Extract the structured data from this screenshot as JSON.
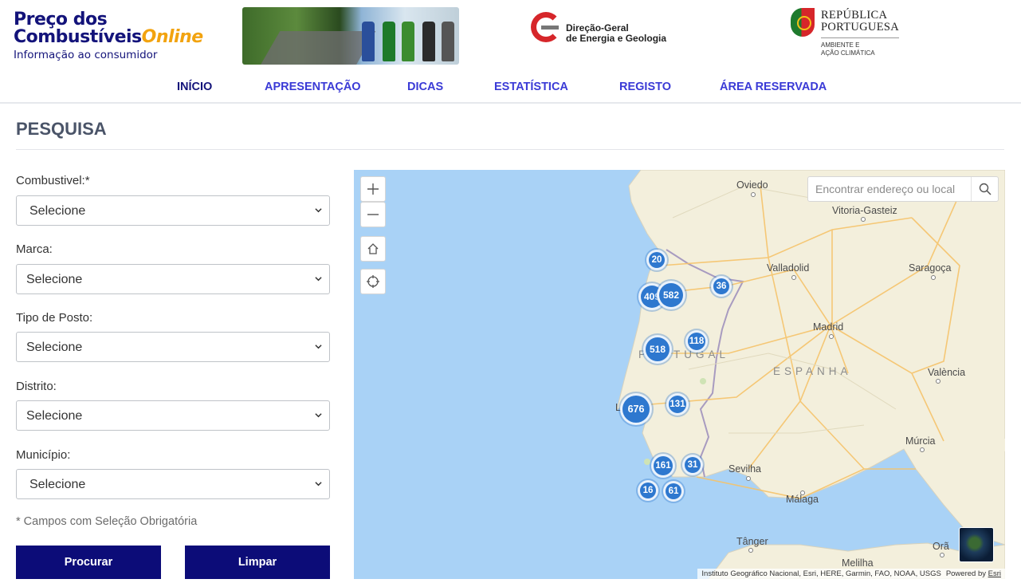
{
  "header": {
    "logo": {
      "line1": "Preço dos",
      "line2_main": "Combustíveis",
      "line2_accent": "Online",
      "subtitle": "Informação ao consumidor"
    },
    "dgeg": {
      "line1": "Direção-Geral",
      "line2": "de Energia e Geologia"
    },
    "republica": {
      "line1": "REPÚBLICA",
      "line2": "PORTUGUESA",
      "sub1": "AMBIENTE E",
      "sub2": "AÇÃO CLIMÁTICA"
    }
  },
  "nav": [
    {
      "label": "INÍCIO",
      "active": true
    },
    {
      "label": "APRESENTAÇÃO",
      "active": false
    },
    {
      "label": "DICAS",
      "active": false
    },
    {
      "label": "ESTATÍSTICA",
      "active": false
    },
    {
      "label": "REGISTO",
      "active": false
    },
    {
      "label": "ÁREA RESERVADA",
      "active": false
    }
  ],
  "page": {
    "title": "PESQUISA"
  },
  "form": {
    "fields": [
      {
        "label": "Combustivel:*",
        "value": "Selecione"
      },
      {
        "label": "Marca:",
        "value": "Selecione"
      },
      {
        "label": "Tipo de Posto:",
        "value": "Selecione"
      },
      {
        "label": "Distrito:",
        "value": "Selecione"
      },
      {
        "label": "Município:",
        "value": "Selecione"
      }
    ],
    "required_note": "* Campos com Seleção Obrigatória",
    "search_button": "Procurar",
    "clear_button": "Limpar"
  },
  "map": {
    "search_placeholder": "Encontrar endereço ou local",
    "controls": [
      "zoom-in",
      "zoom-out",
      "home",
      "locate"
    ],
    "labels": {
      "oviedo": "Oviedo",
      "vitoria": "Vitoria-Gasteiz",
      "valladolid": "Valladolid",
      "saragoca": "Saragoça",
      "madrid": "Madrid",
      "espanha": "ESPANHA",
      "valencia": "València",
      "murcia": "Múrcia",
      "sevilha": "Sevilha",
      "malaga": "Málaga",
      "tanger": "Tânger",
      "melilha": "Melilha",
      "ora": "Orã",
      "portugal": "PORTUGAL",
      "lisboa_l": "L"
    },
    "clusters": [
      "20",
      "409",
      "582",
      "36",
      "118",
      "518",
      "676",
      "131",
      "161",
      "31",
      "16",
      "61"
    ],
    "attribution": "Instituto Geográfico Nacional, Esri, HERE, Garmin, FAO, NOAA, USGS",
    "powered_by": "Powered by",
    "esri": "Esri",
    "colors": {
      "water": "#a9d2f6",
      "land": "#f3efdc",
      "cluster": "#2e78cf",
      "brand": "#13137a",
      "nav": "#3a3ad6",
      "button": "#0c0c78"
    }
  }
}
